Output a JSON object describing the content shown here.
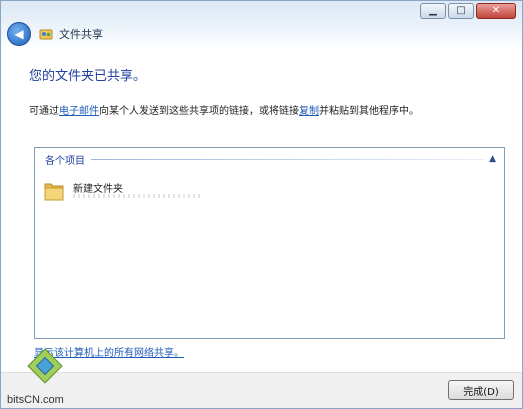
{
  "window": {
    "title": "文件共享",
    "caption_buttons": [
      {
        "name": "minimize",
        "glyph": "▁"
      },
      {
        "name": "maximize",
        "glyph": "□"
      },
      {
        "name": "close",
        "glyph": "✕"
      }
    ]
  },
  "main": {
    "headline": "您的文件夹已共享。",
    "description": {
      "prefix": "可通过",
      "email_link": "电子邮件",
      "middle": "向某个人发送到这些共享项的链接，或将链接",
      "copy_link": "复制",
      "suffix": "并粘贴到其他程序中。"
    },
    "list": {
      "group_label": "各个项目",
      "items": [
        {
          "name": "新建文件夹",
          "icon": "folder-icon"
        }
      ]
    },
    "show_all_link": "显示该计算机上的所有网络共享。"
  },
  "footer": {
    "done_button": "完成(D)"
  },
  "watermark": {
    "text": "bitsCN.com"
  },
  "colors": {
    "headline": "#1e3fa0",
    "link": "#1f5bb8"
  }
}
